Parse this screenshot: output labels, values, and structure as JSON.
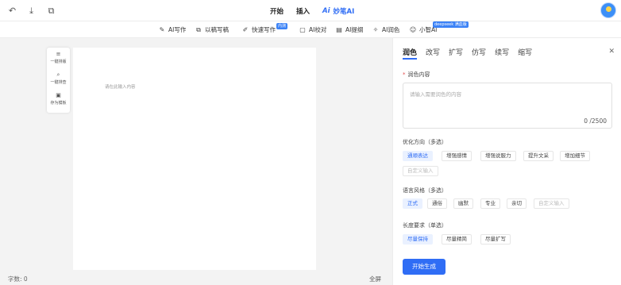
{
  "topbar": {
    "icons": [
      "undo-icon",
      "download-icon",
      "export-icon"
    ],
    "tabs": [
      {
        "label": "开始"
      },
      {
        "label": "插入"
      },
      {
        "label": "妙笔AI",
        "badge": "Ai"
      }
    ]
  },
  "toolbar": {
    "items": [
      {
        "label": "AI写作",
        "icon": "ai-write-icon"
      },
      {
        "label": "以稿写稿",
        "icon": "draft-icon"
      },
      {
        "label": "快速写作",
        "icon": "quick-write-icon",
        "tag": "内测"
      },
      {
        "label": "AI校对",
        "icon": "proofread-icon"
      },
      {
        "label": "AI提纲",
        "icon": "outline-icon"
      },
      {
        "label": "AI润色",
        "icon": "polish-icon"
      },
      {
        "label": "小智AI",
        "icon": "smart-ai-icon",
        "tag": "deepseek 满血版"
      }
    ]
  },
  "canvas": {
    "side_tools": [
      {
        "label": "一键排版",
        "icon": "format-icon"
      },
      {
        "label": "一键排查",
        "icon": "check-icon"
      },
      {
        "label": "存为模板",
        "icon": "template-icon"
      }
    ],
    "paper_placeholder": "请在此输入内容",
    "word_count": "字数: 0",
    "fullscreen": "全屏"
  },
  "panel": {
    "tabs": [
      "润色",
      "改写",
      "扩写",
      "仿写",
      "续写",
      "缩写"
    ],
    "active_tab": "润色",
    "content_label": "润色内容",
    "content_placeholder": "请输入需要润色的内容",
    "char_count": "0 /2500",
    "direction": {
      "label": "优化方向（多选）",
      "options": [
        "通顺表达",
        "增强感情",
        "增强说服力",
        "提升文采",
        "增加细节"
      ],
      "custom": "自定义输入",
      "selected": "通顺表达"
    },
    "style": {
      "label": "语言风格（多选）",
      "options": [
        "正式",
        "通俗",
        "幽默",
        "专业",
        "亲切"
      ],
      "custom": "自定义输入",
      "selected": "正式"
    },
    "length": {
      "label": "长度要求（单选）",
      "options": [
        "尽量保持",
        "尽量精简",
        "尽量扩写"
      ],
      "selected": "尽量保持"
    },
    "start_button": "开始生成",
    "colors": {
      "accent": "#2f6df5",
      "accent_light": "#eaf1ff"
    }
  }
}
